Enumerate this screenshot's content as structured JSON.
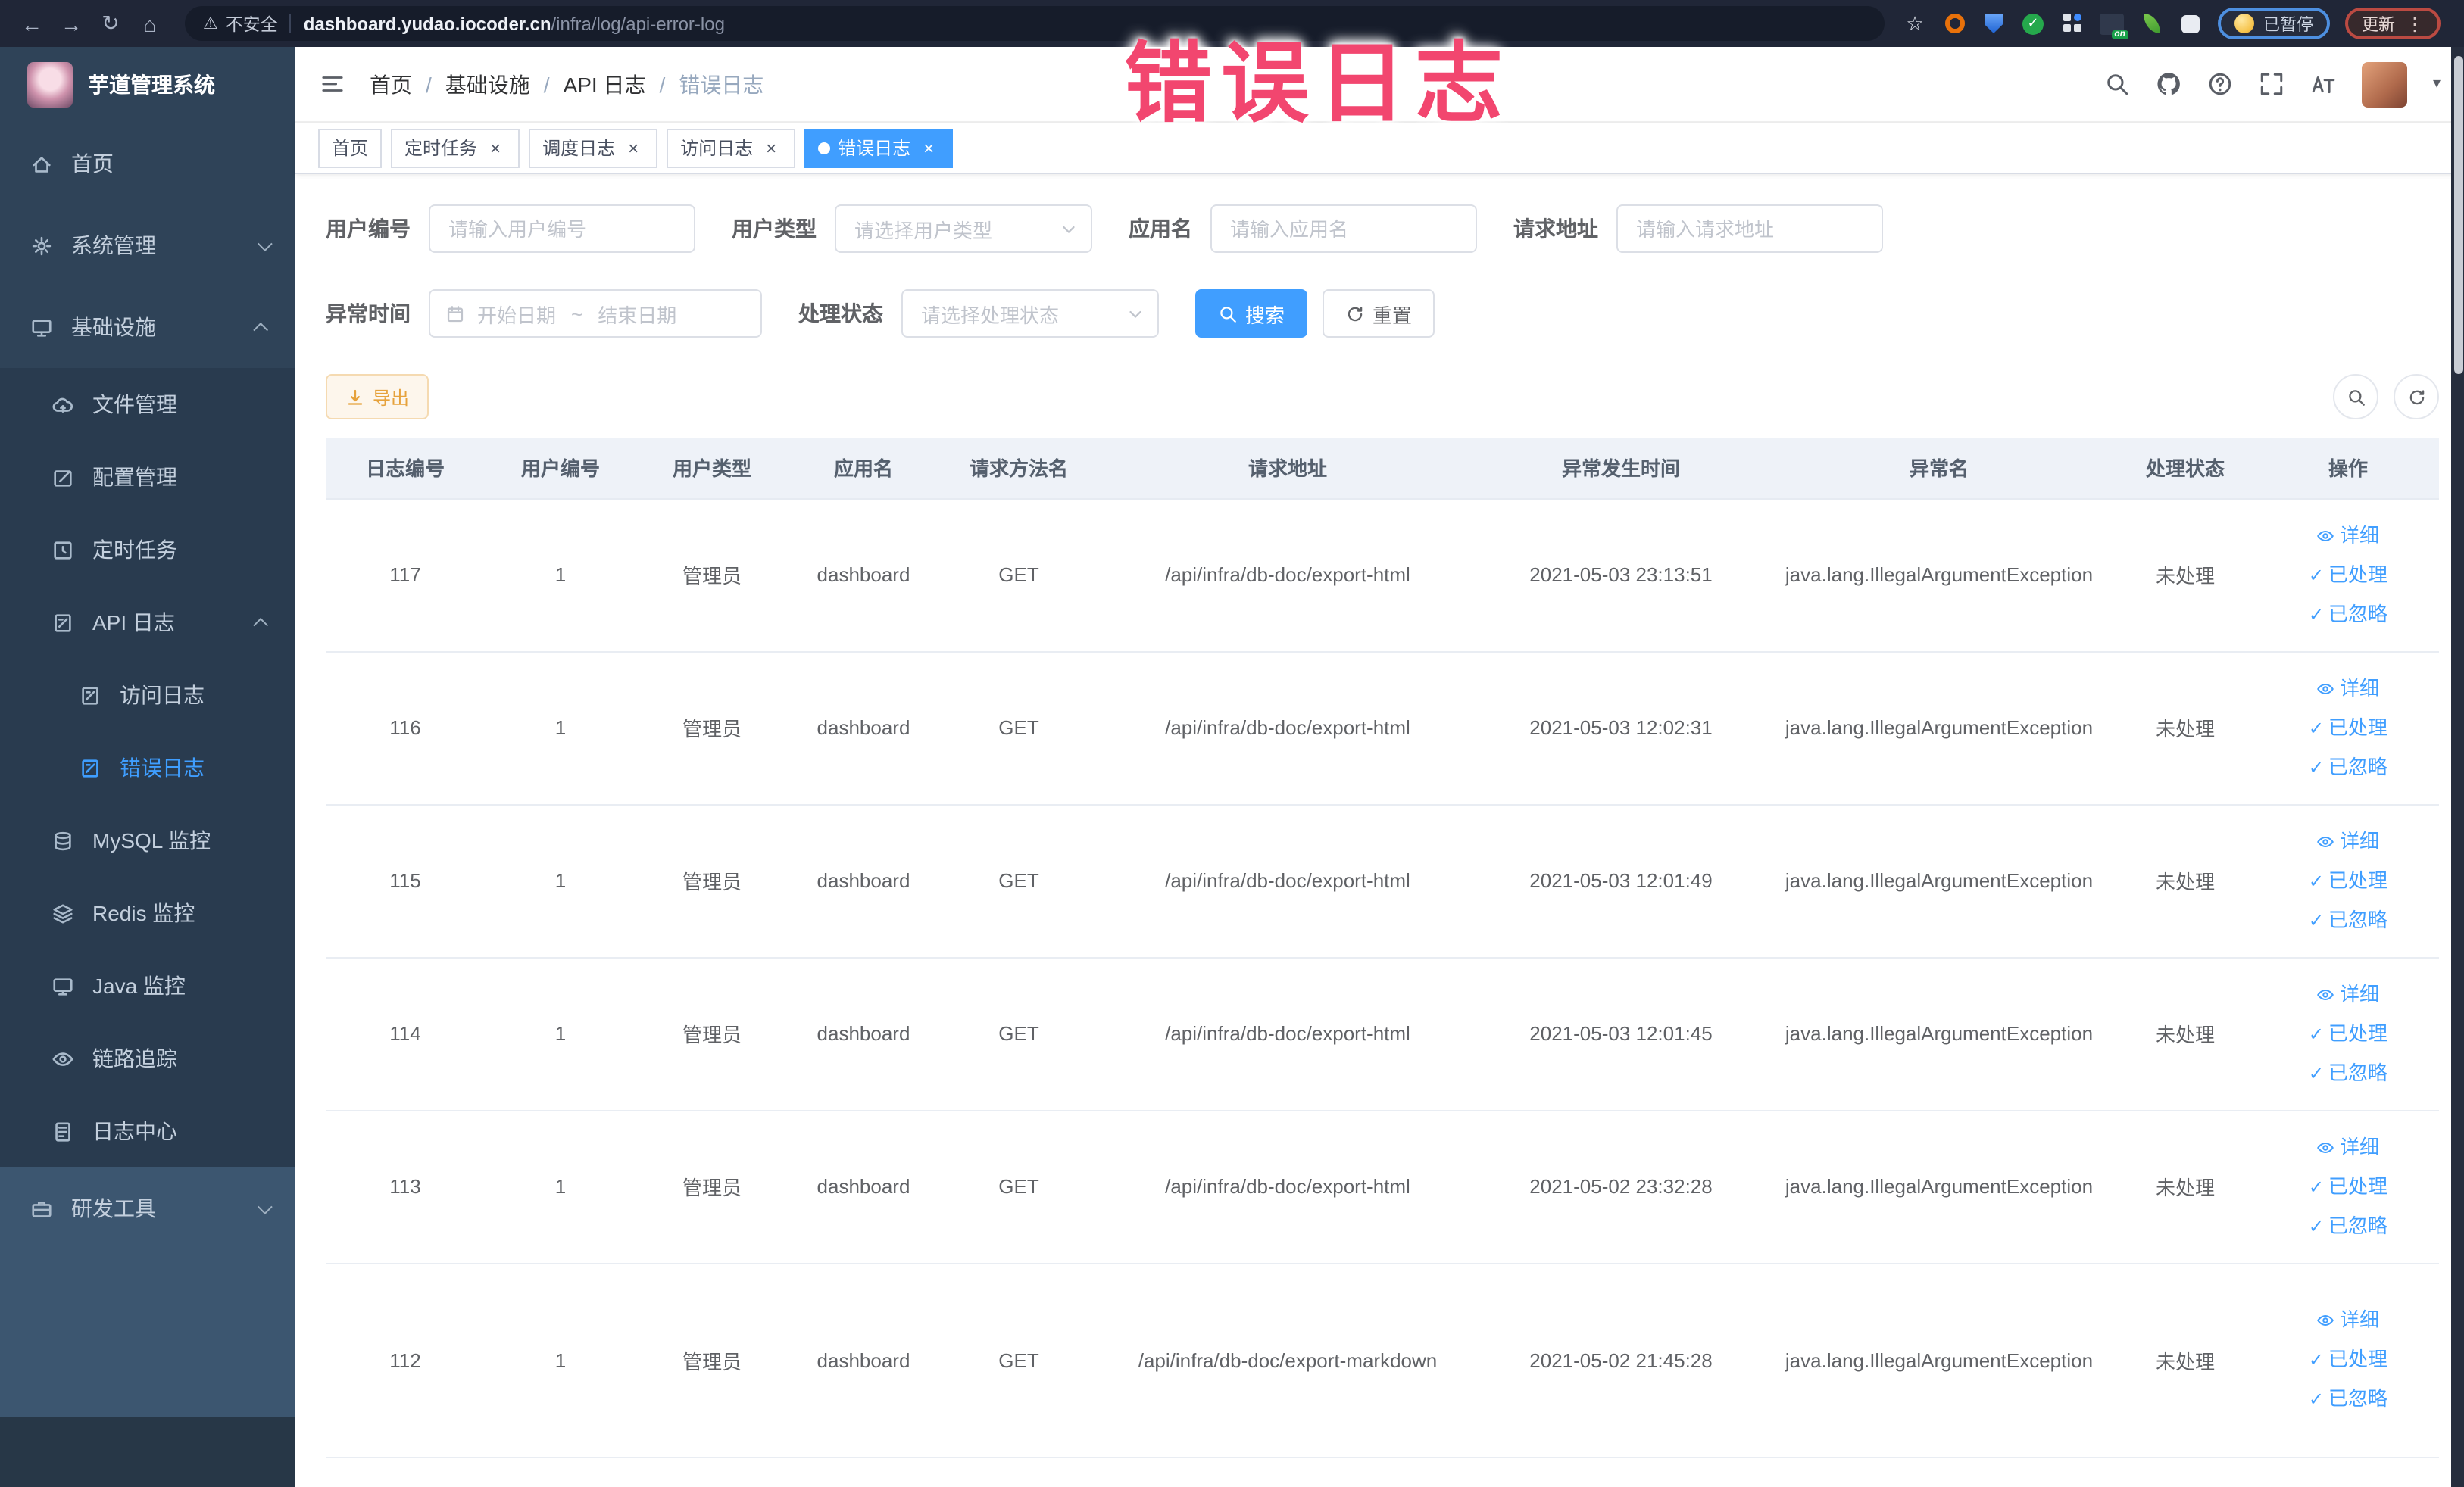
{
  "browser": {
    "security_label": "不安全",
    "url_domain": "dashboard.yudao.iocoder.cn",
    "url_path": "/infra/log/api-error-log",
    "ext_on_label": "on",
    "paused_label": "已暂停",
    "update_label": "更新"
  },
  "icons": {
    "back": "←",
    "forward": "→",
    "reload": "↻",
    "home": "⌂",
    "warning": "⚠",
    "star": "☆",
    "kebab": "⋮",
    "caret_down": "▾",
    "check": "✓",
    "close": "×",
    "breadcrumb_sep": "/"
  },
  "annotation": {
    "text": "错误日志"
  },
  "sidebar": {
    "logo_title": "芋道管理系统",
    "menu": [
      "首页",
      "系统管理",
      "基础设施",
      "文件管理",
      "配置管理",
      "定时任务",
      "API 日志",
      "访问日志",
      "错误日志",
      "MySQL 监控",
      "Redis 监控",
      "Java 监控",
      "链路追踪",
      "日志中心",
      "研发工具"
    ]
  },
  "header": {
    "breadcrumb": [
      "首页",
      "基础设施",
      "API 日志",
      "错误日志"
    ]
  },
  "tabs": [
    "首页",
    "定时任务",
    "调度日志",
    "访问日志",
    "错误日志"
  ],
  "filters": {
    "user_id": {
      "label": "用户编号",
      "placeholder": "请输入用户编号"
    },
    "user_type": {
      "label": "用户类型",
      "placeholder": "请选择用户类型"
    },
    "app_name": {
      "label": "应用名",
      "placeholder": "请输入应用名"
    },
    "request_url": {
      "label": "请求地址",
      "placeholder": "请输入请求地址"
    },
    "exception_time": {
      "label": "异常时间",
      "start_placeholder": "开始日期",
      "separator": "~",
      "end_placeholder": "结束日期"
    },
    "process_status": {
      "label": "处理状态",
      "placeholder": "请选择处理状态"
    },
    "search_button": "搜索",
    "reset_button": "重置"
  },
  "toolbar": {
    "export_button": "导出"
  },
  "table": {
    "columns": [
      "日志编号",
      "用户编号",
      "用户类型",
      "应用名",
      "请求方法名",
      "请求地址",
      "异常发生时间",
      "异常名",
      "处理状态",
      "操作"
    ],
    "op_labels": {
      "detail": "详细",
      "processed": "已处理",
      "ignored": "已忽略"
    },
    "rows": [
      {
        "log_id": "117",
        "user_id": "1",
        "user_type": "管理员",
        "app_name": "dashboard",
        "method": "GET",
        "url": "/api/infra/db-doc/export-html",
        "time": "2021-05-03 23:13:51",
        "exception": "java.lang.IllegalArgumentException",
        "status": "未处理"
      },
      {
        "log_id": "116",
        "user_id": "1",
        "user_type": "管理员",
        "app_name": "dashboard",
        "method": "GET",
        "url": "/api/infra/db-doc/export-html",
        "time": "2021-05-03 12:02:31",
        "exception": "java.lang.IllegalArgumentException",
        "status": "未处理"
      },
      {
        "log_id": "115",
        "user_id": "1",
        "user_type": "管理员",
        "app_name": "dashboard",
        "method": "GET",
        "url": "/api/infra/db-doc/export-html",
        "time": "2021-05-03 12:01:49",
        "exception": "java.lang.IllegalArgumentException",
        "status": "未处理"
      },
      {
        "log_id": "114",
        "user_id": "1",
        "user_type": "管理员",
        "app_name": "dashboard",
        "method": "GET",
        "url": "/api/infra/db-doc/export-html",
        "time": "2021-05-03 12:01:45",
        "exception": "java.lang.IllegalArgumentException",
        "status": "未处理"
      },
      {
        "log_id": "113",
        "user_id": "1",
        "user_type": "管理员",
        "app_name": "dashboard",
        "method": "GET",
        "url": "/api/infra/db-doc/export-html",
        "time": "2021-05-02 23:32:28",
        "exception": "java.lang.IllegalArgumentException",
        "status": "未处理"
      },
      {
        "log_id": "112",
        "user_id": "1",
        "user_type": "管理员",
        "app_name": "dashboard",
        "method": "GET",
        "url": "/api/infra/db-doc/export-markdown",
        "time": "2021-05-02 21:45:28",
        "exception": "java.lang.IllegalArgumentException",
        "status": "未处理"
      }
    ]
  }
}
